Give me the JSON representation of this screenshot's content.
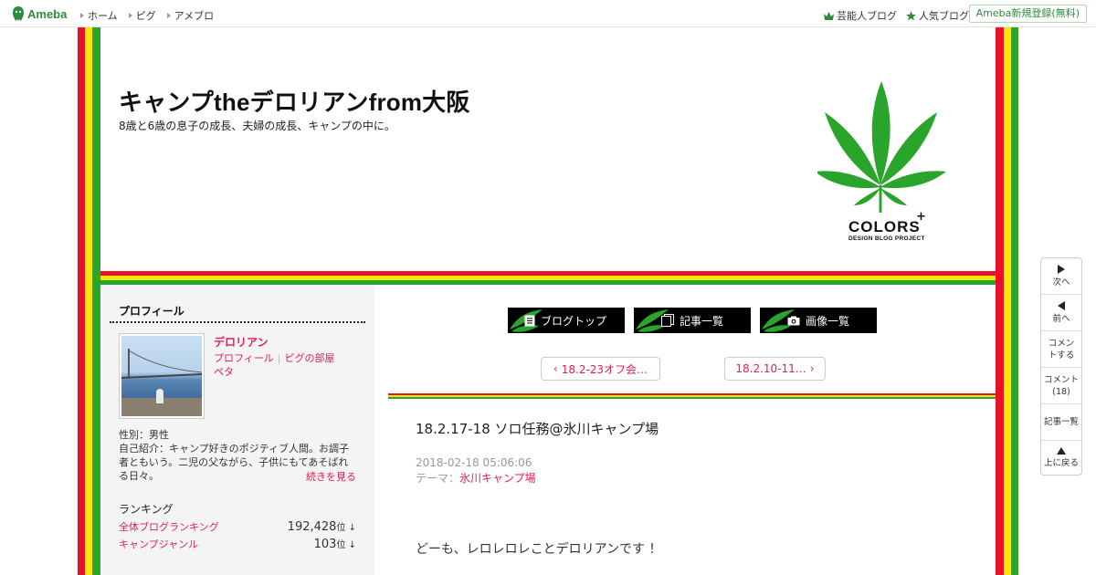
{
  "topbar": {
    "logo_text": "Ameba",
    "nav": [
      "ホーム",
      "ピグ",
      "アメブロ"
    ],
    "celebrity_blog": "芸能人ブログ",
    "popular_blog": "人気ブログ",
    "register": "Ameba新規登録(無料)"
  },
  "header": {
    "title": "キャンプtheデロリアンfrom大阪",
    "description": "8歳と6歳の息子の成長、夫婦の成長、キャンプの中に。",
    "logo_brand": "COLORS",
    "logo_plus": "+",
    "logo_subtitle": "DESIGN BLOG PROJECT"
  },
  "colors": {
    "red": "#e8102a",
    "yellow": "#f6e60a",
    "green": "#2aa52b",
    "link": "#e0214e"
  },
  "sidebar": {
    "heading": "プロフィール",
    "name": "デロリアン",
    "links": [
      "プロフィール",
      "ピグの部屋",
      "ペタ"
    ],
    "info_lines": [
      "性別：男性",
      "自己紹介：キャンプ好きのポジティブ人間。お調子者ともいう。二児の父ながら、子供にもてあそばれる日々。"
    ],
    "more": "続きを見る",
    "ranking_heading": "ランキング",
    "rankings": [
      {
        "label": "全体ブログランキング",
        "value": "192,428",
        "unit": "位 ↓"
      },
      {
        "label": "キャンプジャンル",
        "value": "103",
        "unit": "位 ↓"
      }
    ]
  },
  "main": {
    "nav_buttons": [
      "ブログトップ",
      "記事一覧",
      "画像一覧"
    ],
    "prev_post": "18.2-23オフ会…",
    "next_post": "18.2.10-11…",
    "article": {
      "title": "18.2.17-18 ソロ任務@氷川キャンプ場",
      "date": "2018-02-18 05:06:06",
      "theme_label": "テーマ：",
      "theme": "氷川キャンプ場",
      "first_line": "どーも、レロレロレことデロリアンです ！"
    }
  },
  "floatnav": {
    "next": "次へ",
    "prev": "前へ",
    "comment": "コメントする",
    "comments": "コメント",
    "comment_count": "(18)",
    "articles": "記事一覧",
    "top": "上に戻る"
  }
}
